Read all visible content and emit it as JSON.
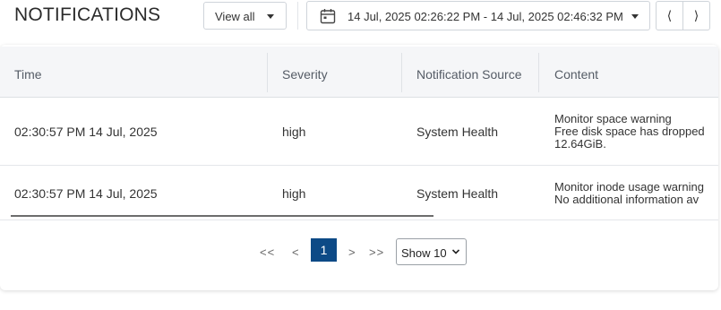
{
  "header": {
    "title": "NOTIFICATIONS",
    "view_filter": "View all",
    "date_range": "14 Jul, 2025 02:26:22 PM - 14 Jul, 2025 02:46:32 PM",
    "prev_symbol": "⟨",
    "next_symbol": "⟩"
  },
  "table": {
    "columns": [
      "Time",
      "Severity",
      "Notification Source",
      "Content"
    ],
    "rows": [
      {
        "time": "02:30:57 PM 14 Jul, 2025",
        "severity": "high",
        "source": "System Health",
        "content": [
          "Monitor space warning",
          "Free disk space has dropped",
          "12.64GiB."
        ]
      },
      {
        "time": "02:30:57 PM 14 Jul, 2025",
        "severity": "high",
        "source": "System Health",
        "content": [
          "Monitor inode usage warning",
          "No additional information av"
        ]
      }
    ]
  },
  "pagination": {
    "first": "<<",
    "prev": "<",
    "current_page": "1",
    "next": ">",
    "last": ">>",
    "page_size": "Show 10"
  },
  "colors": {
    "accent": "#0d4a86",
    "header_bg": "#f5f6f8"
  }
}
